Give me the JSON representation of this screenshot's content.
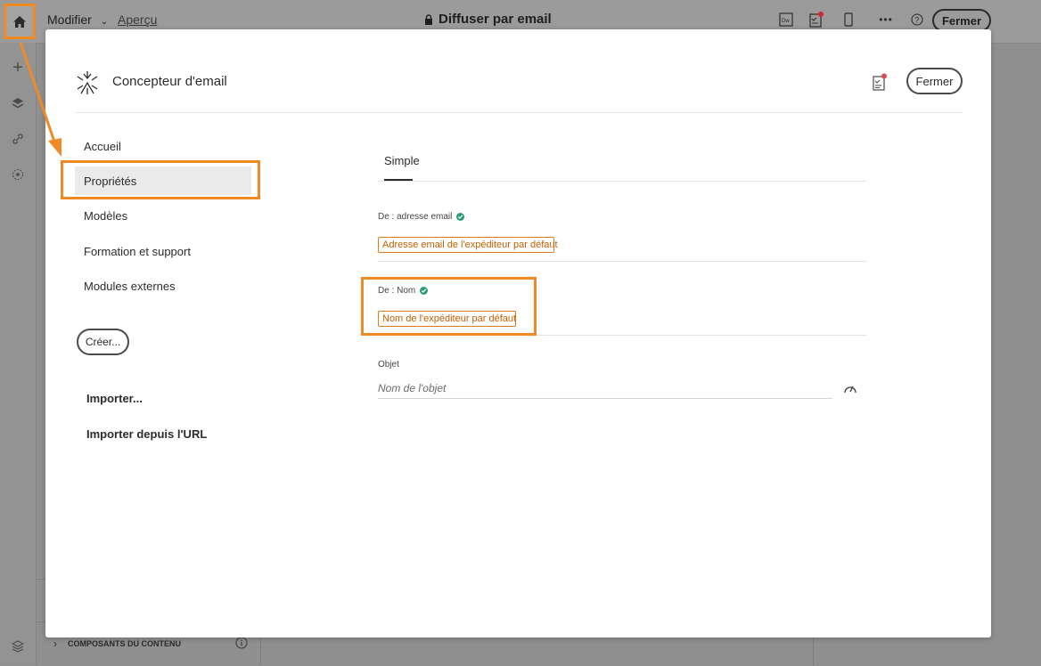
{
  "topbar": {
    "menu_modify": "Modifier",
    "menu_preview": "Aperçu",
    "title": "Diffuser par email",
    "close_label": "Fermer"
  },
  "bottom": {
    "content_components": "COMPOSANTS DU CONTENU"
  },
  "modal": {
    "app_title": "Concepteur d'email",
    "close_label": "Fermer",
    "nav": {
      "items": [
        "Accueil",
        "Propriétés",
        "Modèles",
        "Formation et support",
        "Modules externes"
      ],
      "selected_index": 1,
      "create_label": "Créer...",
      "import_label": "Importer...",
      "import_url_label": "Importer depuis l'URL"
    },
    "tab": "Simple",
    "fields": {
      "from_email_label": "De : adresse email",
      "from_email_value": "Adresse email de l'expéditeur par défaut",
      "from_name_label": "De : Nom",
      "from_name_value": "Nom de l'expéditeur par défaut",
      "subject_label": "Objet",
      "subject_placeholder": "Nom de l'objet"
    }
  },
  "colors": {
    "highlight": "#f08a24",
    "chip_text": "#c45f00",
    "status_ok": "#2d9d78",
    "notification": "#e34850"
  }
}
